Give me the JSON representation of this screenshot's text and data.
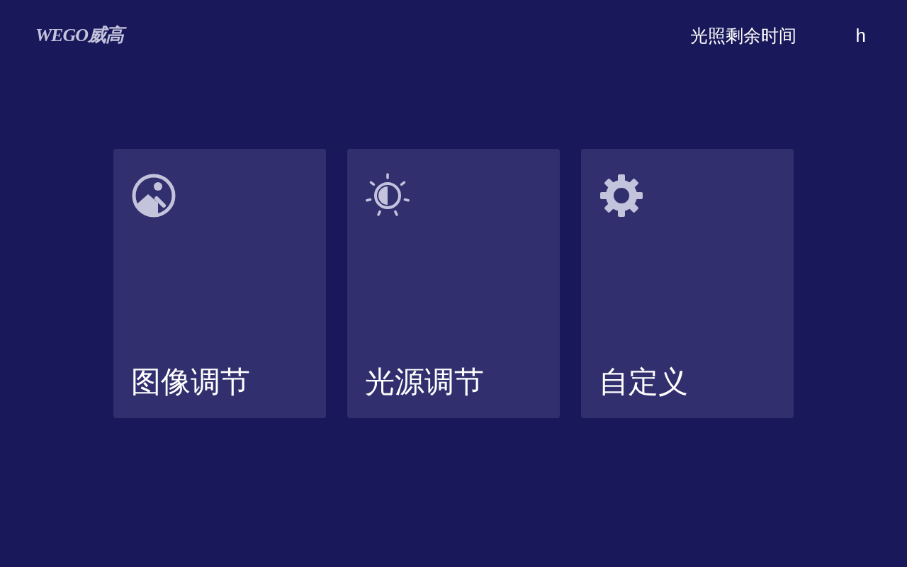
{
  "header": {
    "logo": "WEGO威高",
    "remaining_label": "光照剩余时间",
    "remaining_unit": "h"
  },
  "cards": [
    {
      "kind": "image",
      "label": "图像调节"
    },
    {
      "kind": "light",
      "label": "光源调节"
    },
    {
      "kind": "settings",
      "label": "自定义"
    }
  ]
}
